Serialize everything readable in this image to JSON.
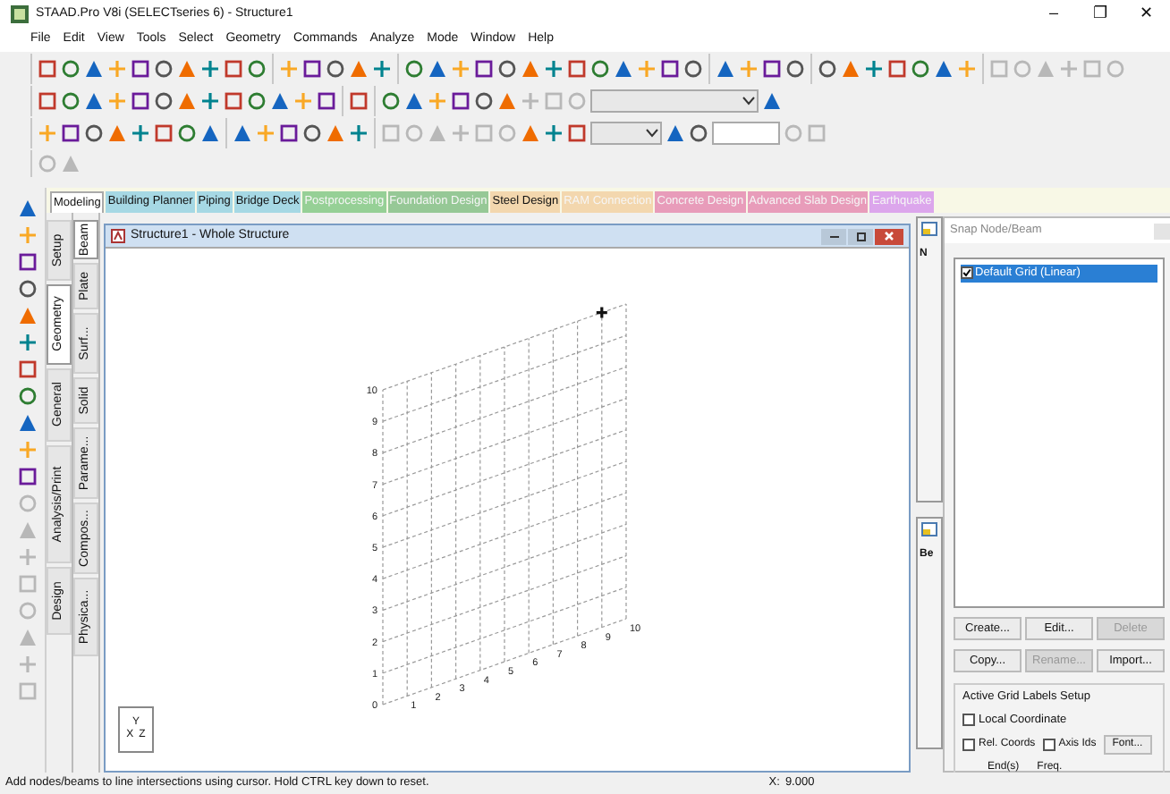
{
  "window": {
    "title": "STAAD.Pro V8i (SELECTseries 6) - Structure1",
    "controls": [
      "–",
      "❐",
      "✕"
    ]
  },
  "menu": [
    "File",
    "Edit",
    "View",
    "Tools",
    "Select",
    "Geometry",
    "Commands",
    "Analyze",
    "Mode",
    "Window",
    "Help"
  ],
  "page_tabs": [
    {
      "label": "Modeling",
      "selected": true,
      "disabled": false
    },
    {
      "label": "Building Planner",
      "selected": false,
      "disabled": false,
      "color": "#a6d8e4"
    },
    {
      "label": "Piping",
      "selected": false,
      "disabled": false,
      "color": "#a6d8e4"
    },
    {
      "label": "Bridge Deck",
      "selected": false,
      "disabled": false,
      "color": "#a6d8e4"
    },
    {
      "label": "Postprocessing",
      "selected": false,
      "disabled": true,
      "color": "#96d096"
    },
    {
      "label": "Foundation Design",
      "selected": false,
      "disabled": true,
      "color": "#96c896"
    },
    {
      "label": "Steel Design",
      "selected": false,
      "disabled": false,
      "color": "#f3d7ae"
    },
    {
      "label": "RAM Connection",
      "selected": false,
      "disabled": true,
      "color": "#f3d7ae"
    },
    {
      "label": "Concrete Design",
      "selected": false,
      "disabled": true,
      "color": "#e89cba"
    },
    {
      "label": "Advanced Slab Design",
      "selected": false,
      "disabled": true,
      "color": "#e89cba"
    },
    {
      "label": "Earthquake",
      "selected": false,
      "disabled": true,
      "color": "#dca6ec"
    }
  ],
  "group_tabs": [
    {
      "label": "Setup",
      "selected": false
    },
    {
      "label": "Geometry",
      "selected": true
    },
    {
      "label": "General",
      "selected": false
    },
    {
      "label": "Analysis/Print",
      "selected": false
    },
    {
      "label": "Design",
      "selected": false
    }
  ],
  "sub_tabs": [
    {
      "label": "Beam",
      "selected": true
    },
    {
      "label": "Plate",
      "selected": false
    },
    {
      "label": "Surf...",
      "selected": false
    },
    {
      "label": "Solid",
      "selected": false
    },
    {
      "label": "Parame...",
      "selected": false
    },
    {
      "label": "Compos...",
      "selected": false
    },
    {
      "label": "Physica...",
      "selected": false
    }
  ],
  "structure_window": {
    "title": "Structure1 - Whole Structure",
    "axis_labels": [
      "Y",
      "X",
      "Z"
    ],
    "grid_labels": {
      "vertical": [
        "10",
        "9",
        "8",
        "7",
        "6",
        "5",
        "4",
        "3",
        "2",
        "1",
        "0"
      ],
      "horizontal": [
        "1",
        "2",
        "3",
        "4",
        "5",
        "6",
        "7",
        "8",
        "9",
        "10"
      ]
    }
  },
  "side_panels": [
    {
      "label": "N"
    },
    {
      "label": "Be"
    }
  ],
  "snap_panel": {
    "title": "Snap Node/Beam",
    "grids": [
      {
        "label": "Default Grid (Linear)",
        "checked": true,
        "selected": true
      }
    ],
    "buttons": [
      {
        "label": "Create...",
        "disabled": false
      },
      {
        "label": "Edit...",
        "disabled": false
      },
      {
        "label": "Delete",
        "disabled": true
      },
      {
        "label": "Copy...",
        "disabled": false
      },
      {
        "label": "Rename...",
        "disabled": true
      },
      {
        "label": "Import...",
        "disabled": false
      }
    ],
    "labels_setup": {
      "title": "Active Grid Labels Setup",
      "options": [
        {
          "label": "Local Coordinate",
          "checked": false
        },
        {
          "label": "Rel. Coords",
          "checked": false
        },
        {
          "label": "Axis Ids",
          "checked": false
        }
      ],
      "font_button": "Font...",
      "columns": [
        "End(s)",
        "Freq."
      ]
    }
  },
  "status_bar": {
    "message": "Add nodes/beams to line intersections using cursor. Hold CTRL key down to reset.",
    "x_label": "X:",
    "x_value": "9.000"
  }
}
